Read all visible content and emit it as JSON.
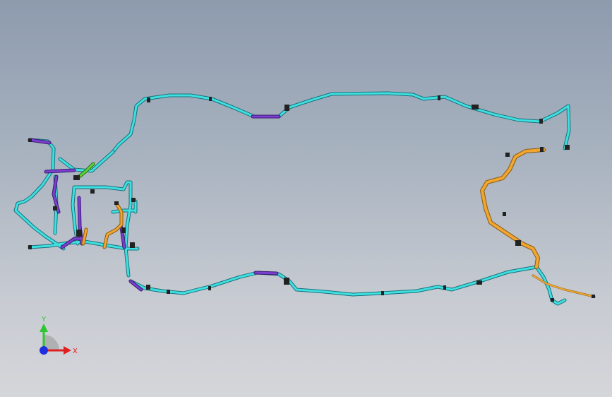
{
  "viewport": {
    "background_top": "#8d9bae",
    "background_bottom": "#d5d6da"
  },
  "colors": {
    "pipe_main": "#3fe0e0",
    "pipe_edge": "#1a6f7a",
    "pipe_purple": "#7b3fd0",
    "pipe_orange": "#f0a630",
    "pipe_green": "#5fd23a",
    "fitting": "#222222"
  },
  "triad": {
    "x_label": "X",
    "y_label": "Y",
    "x_color": "#e02020",
    "y_color": "#2ec62e",
    "z_color": "#1d2fe0"
  }
}
